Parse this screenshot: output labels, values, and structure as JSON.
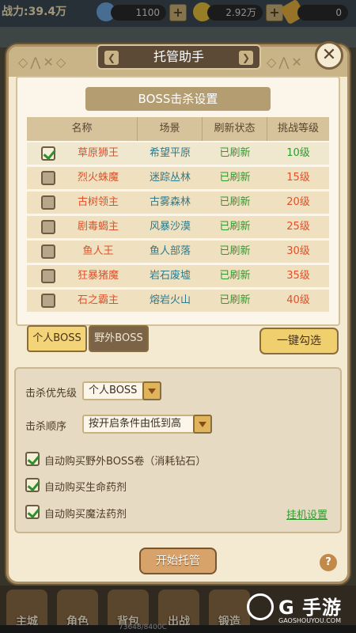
{
  "top_bar": {
    "power": "战力:39.4万",
    "diamonds": "1100",
    "gold": "2.92万",
    "tickets": "0"
  },
  "dialog": {
    "title": "托管助手",
    "section_title": "BOSS击杀设置",
    "table": {
      "headers": [
        "名称",
        "场景",
        "刷新状态",
        "挑战等级"
      ],
      "rows": [
        {
          "name": "草原狮王",
          "scene": "希望平原",
          "status": "已刷新",
          "level": "10级",
          "checked": true
        },
        {
          "name": "烈火蛛魔",
          "scene": "迷踪丛林",
          "status": "已刷新",
          "level": "15级",
          "checked": false
        },
        {
          "name": "古树领主",
          "scene": "古雾森林",
          "status": "已刷新",
          "level": "20级",
          "checked": false
        },
        {
          "name": "剧毒蝎主",
          "scene": "风暴沙漠",
          "status": "已刷新",
          "level": "25级",
          "checked": false
        },
        {
          "name": "鱼人王",
          "scene": "鱼人部落",
          "status": "已刷新",
          "level": "30级",
          "checked": false
        },
        {
          "name": "狂暴猪魔",
          "scene": "岩石废墟",
          "status": "已刷新",
          "level": "35级",
          "checked": false
        },
        {
          "name": "石之霸主",
          "scene": "熔岩火山",
          "status": "已刷新",
          "level": "40级",
          "checked": false
        }
      ]
    },
    "tabs": [
      "个人BOSS",
      "野外BOSS"
    ],
    "select_all": "一键勾选",
    "settings": {
      "priority_label": "击杀优先级",
      "priority_value": "个人BOSS",
      "order_label": "击杀顺序",
      "order_value": "按开启条件由低到高",
      "options": [
        {
          "label": "自动购买野外BOSS卷（消耗钻石）",
          "checked": true
        },
        {
          "label": "自动购买生命药剂",
          "checked": true
        },
        {
          "label": "自动购买魔法药剂",
          "checked": true
        }
      ],
      "link": "挂机设置"
    },
    "start_button": "开始托管",
    "help": "?"
  },
  "bottom_nav": [
    "主城",
    "角色",
    "背包",
    "出战",
    "锻造"
  ],
  "exp_text": "73648/8400C",
  "watermark": {
    "text": "G 手游",
    "sub": "GAOSHOUYOU.COM"
  },
  "colors": {
    "panel_bg": "#f4ead2",
    "accent_red": "#e0502a",
    "accent_green": "#2e9a2e",
    "scene_teal": "#2f7a8a"
  }
}
